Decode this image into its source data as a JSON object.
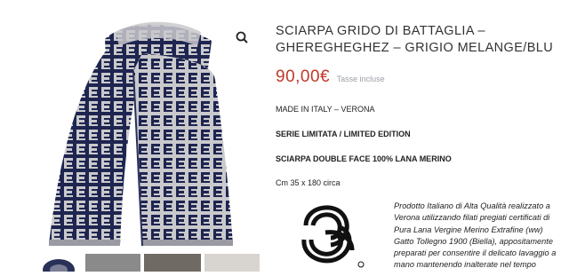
{
  "product": {
    "title": "SCIARPA GRIDO DI BATTAGLIA – GHEREGHEGHEZ – GRIGIO MELANGE/BLU",
    "price": "90,00€",
    "price_suffix": "Tasse incluse",
    "origin": "MADE IN ITALY – VERONA",
    "edition": "SERIE LIMITATA / LIMITED EDITION",
    "material": "SCIARPA DOUBLE FACE 100% LANA MERINO",
    "size": "Cm 35 x 180 circa",
    "description": "Prodotto Italiano di Alta Qualità realizzato a Verona utilizzando filati pregiati certificati di Pura Lana Vergine Merino Extrafine (ww) Gatto Tollegno 1900 (Biella), appositamente preparati per consentire il delicato lavaggio a mano mantenendo inalterate nel tempo"
  },
  "gallery": {
    "zoom_icon": "search-icon",
    "colors": {
      "navy": "#1e2550",
      "grey": "#c9c9cc",
      "price_red": "#c0392b"
    }
  }
}
